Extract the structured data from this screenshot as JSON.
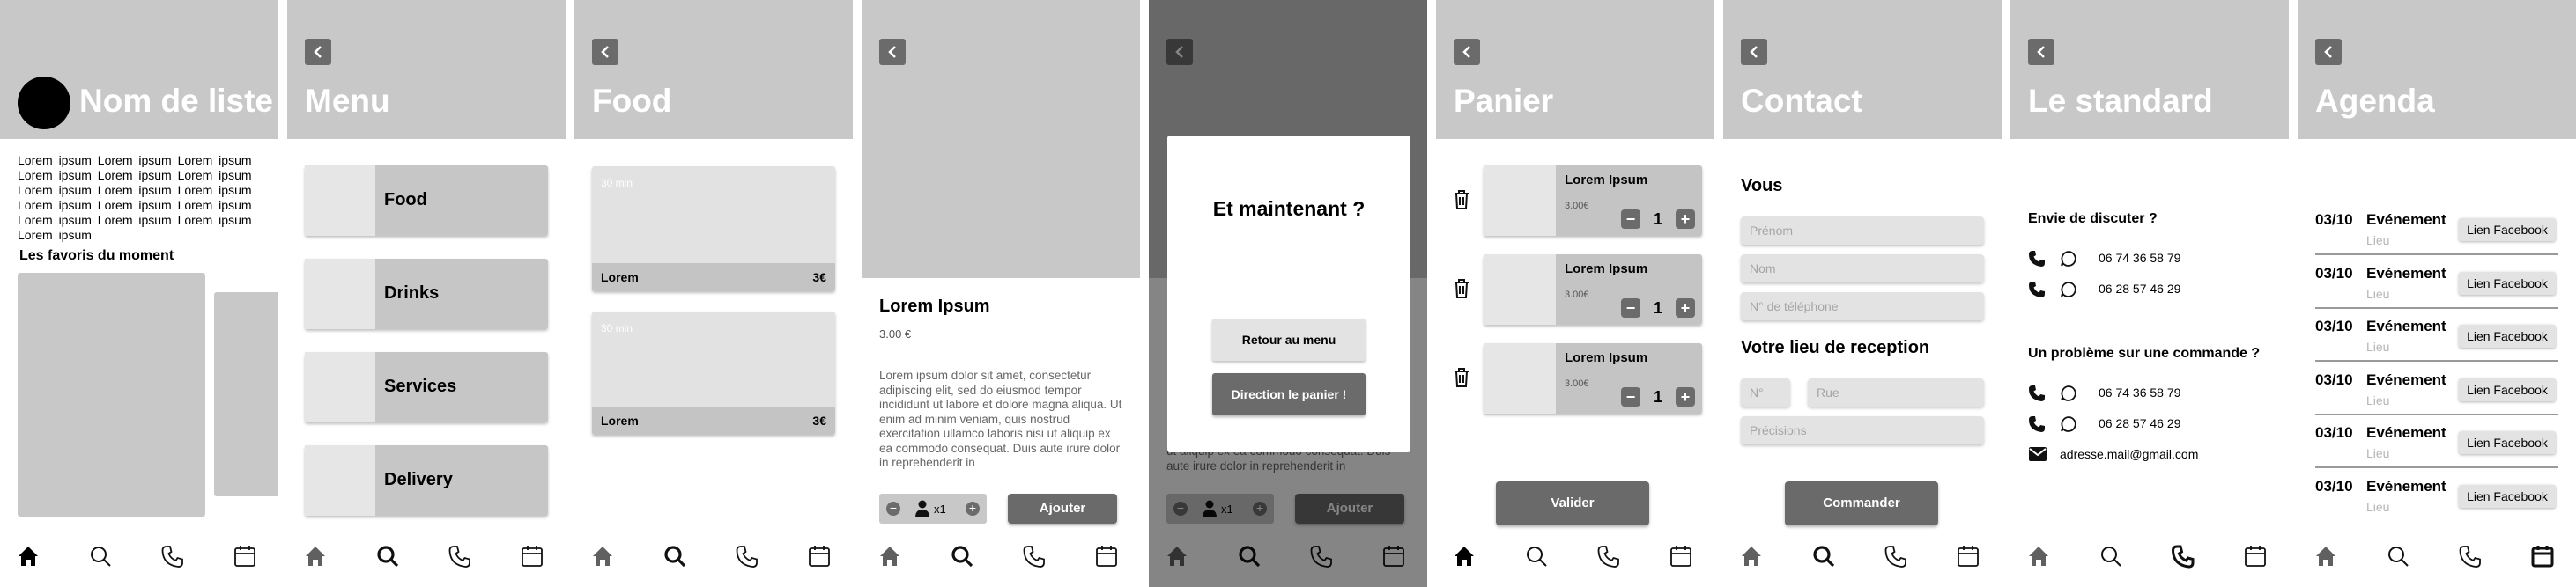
{
  "colors": {
    "header": "#c8c8c8",
    "card": "#c6c6c6",
    "dark": "#6b6b6b",
    "overlay": "rgba(0,0,0,0.45)"
  },
  "tabs": [
    {
      "name": "home-icon"
    },
    {
      "name": "search-icon"
    },
    {
      "name": "phone-icon"
    },
    {
      "name": "calendar-icon"
    }
  ],
  "list_screen": {
    "title": "Nom de liste",
    "paragraph": "Lorem ipsum Lorem ipsum Lorem ipsum Lorem ipsum Lorem ipsum Lorem ipsum Lorem ipsum Lorem ipsum Lorem ipsum Lorem ipsum Lorem ipsum Lorem ipsum Lorem ipsum Lorem ipsum Lorem ipsum Lorem ipsum",
    "favorites_title": "Les favoris du moment",
    "active_tab": "home"
  },
  "menu_screen": {
    "title": "Menu",
    "items": [
      "Food",
      "Drinks",
      "Services",
      "Delivery"
    ],
    "active_tab": "search"
  },
  "food_screen": {
    "title": "Food",
    "items": [
      {
        "time": "30 min",
        "name": "Lorem",
        "price": "3€"
      },
      {
        "time": "30 min",
        "name": "Lorem",
        "price": "3€"
      }
    ],
    "active_tab": "search"
  },
  "product_screen": {
    "name": "Lorem Ipsum",
    "price": "3.00 €",
    "description": "Lorem ipsum dolor sit amet, consectetur adipiscing elit, sed do eiusmod tempor incididunt ut labore et dolore magna aliqua. Ut enim ad minim veniam, quis nostrud exercitation ullamco laboris nisi ut aliquip ex ea commodo consequat. Duis aute irure dolor in reprehenderit in",
    "quantity": "x1",
    "add_label": "Ajouter",
    "active_tab": "search"
  },
  "modal_screen": {
    "modal_title": "Et maintenant ?",
    "back_label": "Retour au menu",
    "cart_label": "Direction le panier !",
    "bg_text": "ut aliquip ex ea commodo consequat. Duis aute irure dolor in reprehenderit in",
    "quantity": "x1",
    "add_label": "Ajouter",
    "active_tab": "search"
  },
  "cart_screen": {
    "title": "Panier",
    "items": [
      {
        "name": "Lorem Ipsum",
        "price": "3.00€",
        "qty": "1"
      },
      {
        "name": "Lorem Ipsum",
        "price": "3.00€",
        "qty": "1"
      },
      {
        "name": "Lorem Ipsum",
        "price": "3.00€",
        "qty": "1"
      }
    ],
    "validate_label": "Valider",
    "active_tab": "home"
  },
  "contact_screen": {
    "title": "Contact",
    "you_title": "Vous",
    "firstname_placeholder": "Prénom",
    "name_placeholder": "Nom",
    "phone_placeholder": "N° de téléphone",
    "place_title": "Votre lieu de reception",
    "number_placeholder": "N°",
    "street_placeholder": "Rue",
    "details_placeholder": "Précisions",
    "order_label": "Commander",
    "active_tab": "search"
  },
  "standard_screen": {
    "title": "Le standard",
    "chat_title": "Envie de discuter ?",
    "chat_phones": [
      "06 74 36 58 79",
      "06 28 57 46 29"
    ],
    "problem_title": "Un problème sur une commande ?",
    "problem_phones": [
      "06 74 36 58 79",
      "06 28 57 46 29"
    ],
    "email": "adresse.mail@gmail.com",
    "active_tab": "phone"
  },
  "agenda_screen": {
    "title": "Agenda",
    "events": [
      {
        "date": "03/10",
        "event": "Evénement",
        "place": "Lieu",
        "link": "Lien Facebook"
      },
      {
        "date": "03/10",
        "event": "Evénement",
        "place": "Lieu",
        "link": "Lien Facebook"
      },
      {
        "date": "03/10",
        "event": "Evénement",
        "place": "Lieu",
        "link": "Lien Facebook"
      },
      {
        "date": "03/10",
        "event": "Evénement",
        "place": "Lieu",
        "link": "Lien Facebook"
      },
      {
        "date": "03/10",
        "event": "Evénement",
        "place": "Lieu",
        "link": "Lien Facebook"
      },
      {
        "date": "03/10",
        "event": "Evénement",
        "place": "Lieu",
        "link": "Lien Facebook"
      }
    ],
    "active_tab": "calendar"
  }
}
